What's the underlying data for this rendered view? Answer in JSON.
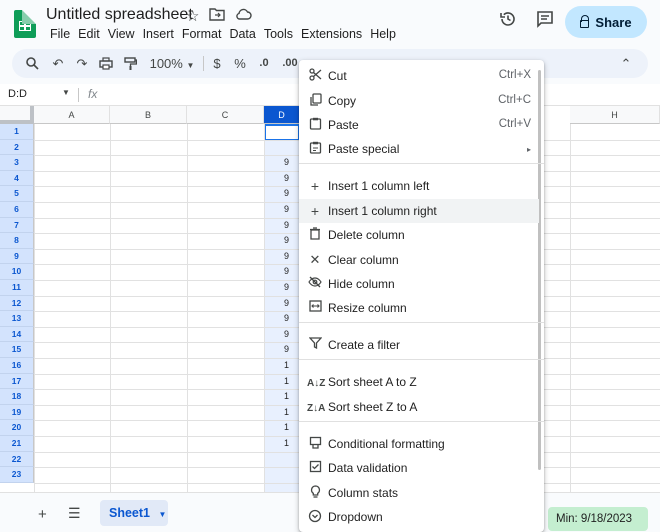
{
  "app": {
    "title": "Untitled spreadsheet",
    "menus": [
      "File",
      "Edit",
      "View",
      "Insert",
      "Format",
      "Data",
      "Tools",
      "Extensions",
      "Help"
    ],
    "share_label": "Share",
    "brand_color": "#0f9d58"
  },
  "toolbar": {
    "zoom": "100%",
    "currency": "$",
    "percent": "%",
    "decrease_decimal": ".0",
    "increase_decimal": ".00"
  },
  "formula_bar": {
    "name_box": "D:D",
    "fx": "fx"
  },
  "grid": {
    "columns": [
      "A",
      "B",
      "C",
      "D",
      "H"
    ],
    "rows": [
      "1",
      "2",
      "3",
      "4",
      "5",
      "6",
      "7",
      "8",
      "9",
      "10",
      "11",
      "12",
      "13",
      "14",
      "15",
      "16",
      "17",
      "18",
      "19",
      "20",
      "21",
      "22",
      "23"
    ],
    "col_d_values": [
      "",
      "",
      "9",
      "9",
      "9",
      "9",
      "9",
      "9",
      "9",
      "9",
      "9",
      "9",
      "9",
      "9",
      "9",
      "1",
      "1",
      "1",
      "1",
      "1",
      "1",
      "",
      ""
    ]
  },
  "context_menu": {
    "items": [
      {
        "label": "Cut",
        "shortcut": "Ctrl+X",
        "icon": "scissors-icon"
      },
      {
        "label": "Copy",
        "shortcut": "Ctrl+C",
        "icon": "copy-icon"
      },
      {
        "label": "Paste",
        "shortcut": "Ctrl+V",
        "icon": "paste-icon"
      },
      {
        "label": "Paste special",
        "shortcut": "▸",
        "icon": "paste-special-icon"
      },
      {
        "label": "Insert 1 column left",
        "shortcut": "",
        "icon": "plus-icon"
      },
      {
        "label": "Insert 1 column right",
        "shortcut": "",
        "icon": "plus-icon"
      },
      {
        "label": "Delete column",
        "shortcut": "",
        "icon": "trash-icon"
      },
      {
        "label": "Clear column",
        "shortcut": "",
        "icon": "close-icon"
      },
      {
        "label": "Hide column",
        "shortcut": "",
        "icon": "eye-off-icon"
      },
      {
        "label": "Resize column",
        "shortcut": "",
        "icon": "resize-icon"
      },
      {
        "label": "Create a filter",
        "shortcut": "",
        "icon": "filter-icon"
      },
      {
        "label": "Sort sheet A to Z",
        "shortcut": "",
        "icon": "sort-az-icon"
      },
      {
        "label": "Sort sheet Z to A",
        "shortcut": "",
        "icon": "sort-za-icon"
      },
      {
        "label": "Conditional formatting",
        "shortcut": "",
        "icon": "conditional-format-icon"
      },
      {
        "label": "Data validation",
        "shortcut": "",
        "icon": "data-validation-icon"
      },
      {
        "label": "Column stats",
        "shortcut": "",
        "icon": "lightbulb-icon"
      },
      {
        "label": "Dropdown",
        "shortcut": "",
        "icon": "dropdown-icon"
      }
    ]
  },
  "footer": {
    "sheet_tab": "Sheet1",
    "stat": "Min: 9/18/2023"
  }
}
